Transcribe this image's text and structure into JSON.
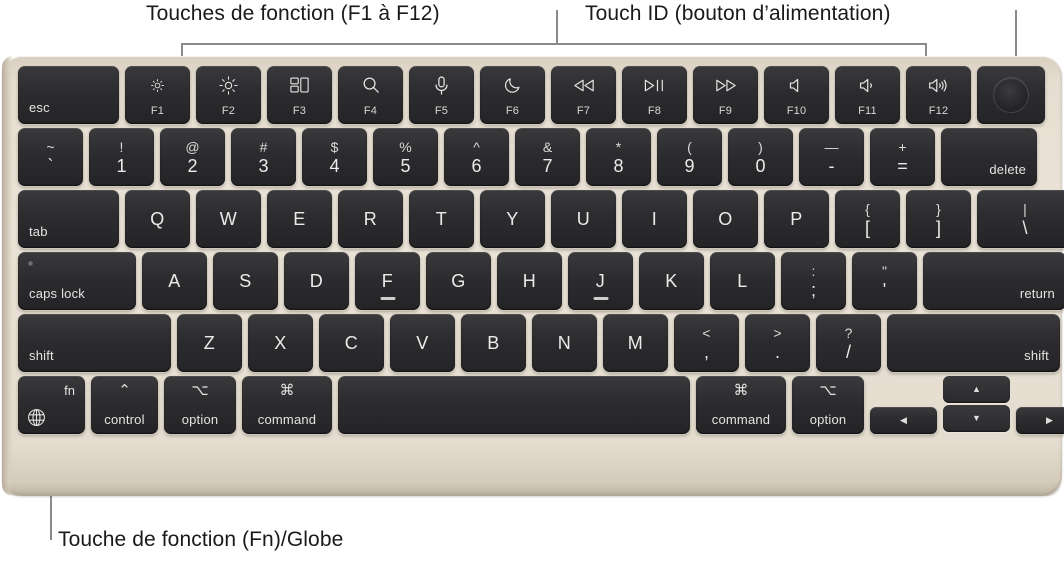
{
  "callouts": {
    "fn_keys": "Touches de fonction (F1 à F12)",
    "touch_id": "Touch ID (bouton d’alimentation)",
    "fn_globe": "Touche de fonction (Fn)/Globe"
  },
  "colors": {
    "chassis": "#e6ded1",
    "key": "#2c2c2e",
    "key_text": "#ebebec",
    "leader_line": "#8a8a8a",
    "label_text": "#1a1a1a"
  },
  "keyboard": {
    "rows": {
      "function_row": [
        {
          "name": "esc",
          "label": "esc",
          "icon": ""
        },
        {
          "name": "f1",
          "label": "F1",
          "icon": "brightness-down-icon"
        },
        {
          "name": "f2",
          "label": "F2",
          "icon": "brightness-up-icon"
        },
        {
          "name": "f3",
          "label": "F3",
          "icon": "mission-control-icon"
        },
        {
          "name": "f4",
          "label": "F4",
          "icon": "spotlight-search-icon"
        },
        {
          "name": "f5",
          "label": "F5",
          "icon": "dictation-microphone-icon"
        },
        {
          "name": "f6",
          "label": "F6",
          "icon": "do-not-disturb-moon-icon"
        },
        {
          "name": "f7",
          "label": "F7",
          "icon": "rewind-icon"
        },
        {
          "name": "f8",
          "label": "F8",
          "icon": "play-pause-icon"
        },
        {
          "name": "f9",
          "label": "F9",
          "icon": "fast-forward-icon"
        },
        {
          "name": "f10",
          "label": "F10",
          "icon": "mute-icon"
        },
        {
          "name": "f11",
          "label": "F11",
          "icon": "volume-down-icon"
        },
        {
          "name": "f12",
          "label": "F12",
          "icon": "volume-up-icon"
        },
        {
          "name": "touch-id",
          "label": "",
          "icon": "touch-id-icon"
        }
      ],
      "number_row": [
        {
          "top": "~",
          "bottom": "`"
        },
        {
          "top": "!",
          "bottom": "1"
        },
        {
          "top": "@",
          "bottom": "2"
        },
        {
          "top": "#",
          "bottom": "3"
        },
        {
          "top": "$",
          "bottom": "4"
        },
        {
          "top": "%",
          "bottom": "5"
        },
        {
          "top": "^",
          "bottom": "6"
        },
        {
          "top": "&",
          "bottom": "7"
        },
        {
          "top": "*",
          "bottom": "8"
        },
        {
          "top": "(",
          "bottom": "9"
        },
        {
          "top": ")",
          "bottom": "0"
        },
        {
          "top": "—",
          "bottom": "-"
        },
        {
          "top": "+",
          "bottom": "="
        }
      ],
      "delete_key": "delete",
      "tab_key": "tab",
      "qwerty_row": [
        "Q",
        "W",
        "E",
        "R",
        "T",
        "Y",
        "U",
        "I",
        "O",
        "P"
      ],
      "qwerty_bracket_keys": [
        {
          "top": "{",
          "bottom": "["
        },
        {
          "top": "}",
          "bottom": "]"
        },
        {
          "top": "|",
          "bottom": "\\"
        }
      ],
      "caps_lock_key": "caps lock",
      "home_row": [
        "A",
        "S",
        "D",
        "F",
        "G",
        "H",
        "J",
        "K",
        "L"
      ],
      "home_row_punct": [
        {
          "top": ":",
          "bottom": ";"
        },
        {
          "top": "\"",
          "bottom": "'"
        }
      ],
      "return_key": "return",
      "shift_left_key": "shift",
      "shift_row": [
        "Z",
        "X",
        "C",
        "V",
        "B",
        "N",
        "M"
      ],
      "shift_row_punct": [
        {
          "top": "<",
          "bottom": ","
        },
        {
          "top": ">",
          "bottom": "."
        },
        {
          "top": "?",
          "bottom": "/"
        }
      ],
      "shift_right_key": "shift",
      "modifier_row": {
        "fn": "fn",
        "control": {
          "symbol": "⌃",
          "word": "control"
        },
        "option_left": {
          "symbol": "⌥",
          "word": "option"
        },
        "command_left": {
          "symbol": "⌘",
          "word": "command"
        },
        "space": "",
        "command_right": {
          "symbol": "⌘",
          "word": "command"
        },
        "option_right": {
          "symbol": "⌥",
          "word": "option"
        },
        "arrow_left": "◀",
        "arrow_up": "▲",
        "arrow_down": "▼",
        "arrow_right": "▶"
      }
    }
  }
}
